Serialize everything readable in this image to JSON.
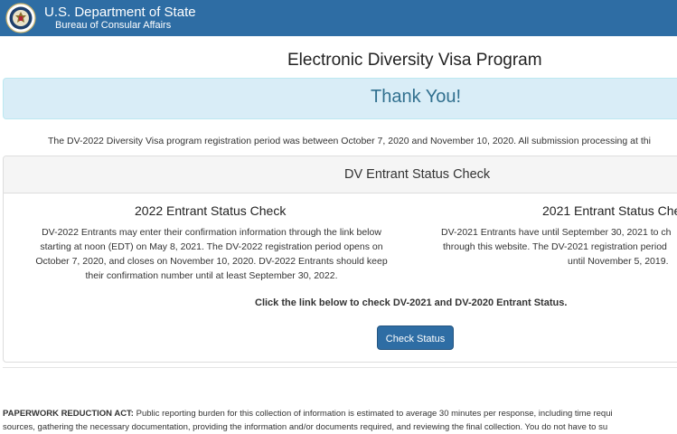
{
  "header": {
    "agency": "U.S. Department of State",
    "bureau": "Bureau of Consular Affairs",
    "seal_icon": "state-department-seal-icon",
    "background_color": "#2e6da4"
  },
  "page_title": "Electronic Diversity Visa Program",
  "thank_you": "Thank You!",
  "notice": "The DV-2022 Diversity Visa program registration period was between October 7, 2020 and November 10, 2020. All submission processing at thi",
  "panel": {
    "title": "DV Entrant Status Check",
    "left": {
      "title": "2022 Entrant Status Check",
      "lines": [
        "DV-2022 Entrants may enter their confirmation information through the link below",
        "starting at noon (EDT) on May 8, 2021. The DV-2022 registration period opens on",
        "October 7, 2020, and closes on November 10, 2020. DV-2022 Entrants should keep",
        "their confirmation number until at least September 30, 2022."
      ]
    },
    "right": {
      "title": "2021 Entrant Status Che",
      "lines": [
        "DV-2021 Entrants have until September 30, 2021 to ch",
        "through this website. The DV-2021 registration period",
        "until November 5, 2019."
      ]
    },
    "click_text": "Click the link below to check DV-2021 and DV-2020 Entrant Status.",
    "button_label": "Check Status"
  },
  "paperwork": {
    "label": "PAPERWORK REDUCTION ACT:",
    "line1": " Public reporting burden for this collection of information is estimated to average 30 minutes per response, including time requi",
    "line2": "sources, gathering the necessary documentation, providing the information and/or documents required, and reviewing the final collection. You do not have to su"
  }
}
